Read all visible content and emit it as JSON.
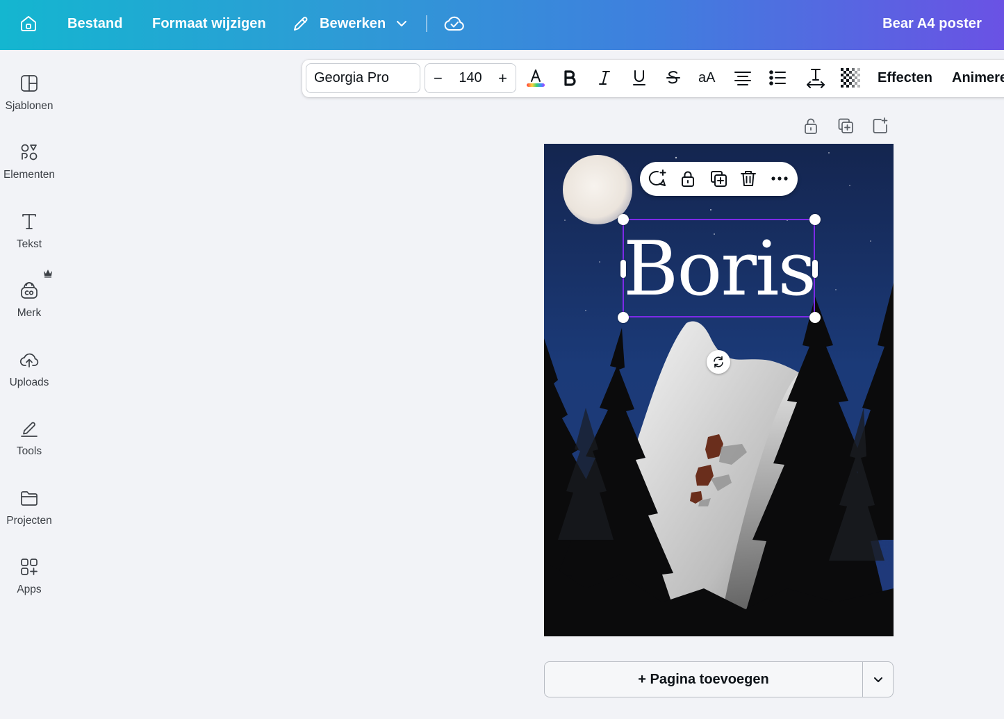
{
  "topbar": {
    "home_label": "",
    "file_label": "Bestand",
    "resize_label": "Formaat wijzigen",
    "edit_label": "Bewerken",
    "title": "Bear A4 poster"
  },
  "sidebar": {
    "items": [
      {
        "label": "Sjablonen",
        "icon": "template-icon"
      },
      {
        "label": "Elementen",
        "icon": "elements-icon"
      },
      {
        "label": "Tekst",
        "icon": "text-icon"
      },
      {
        "label": "Merk",
        "icon": "brand-icon"
      },
      {
        "label": "Uploads",
        "icon": "upload-cloud-icon"
      },
      {
        "label": "Tools",
        "icon": "draw-tool-icon"
      },
      {
        "label": "Projecten",
        "icon": "folder-icon"
      },
      {
        "label": "Apps",
        "icon": "apps-icon"
      }
    ]
  },
  "format_toolbar": {
    "font_family": "Georgia Pro",
    "font_size": "140",
    "decrease": "−",
    "increase": "+",
    "case_label": "aA",
    "effects_label": "Effecten",
    "animate_label": "Animeren"
  },
  "canvas": {
    "text": "Boris"
  },
  "add_page": {
    "label": "+ Pagina toevoegen"
  },
  "colors": {
    "selection": "#7d2ae8",
    "sky": "#1b3266",
    "gradient_start": "#14b6d0",
    "gradient_end": "#6a52e4"
  }
}
